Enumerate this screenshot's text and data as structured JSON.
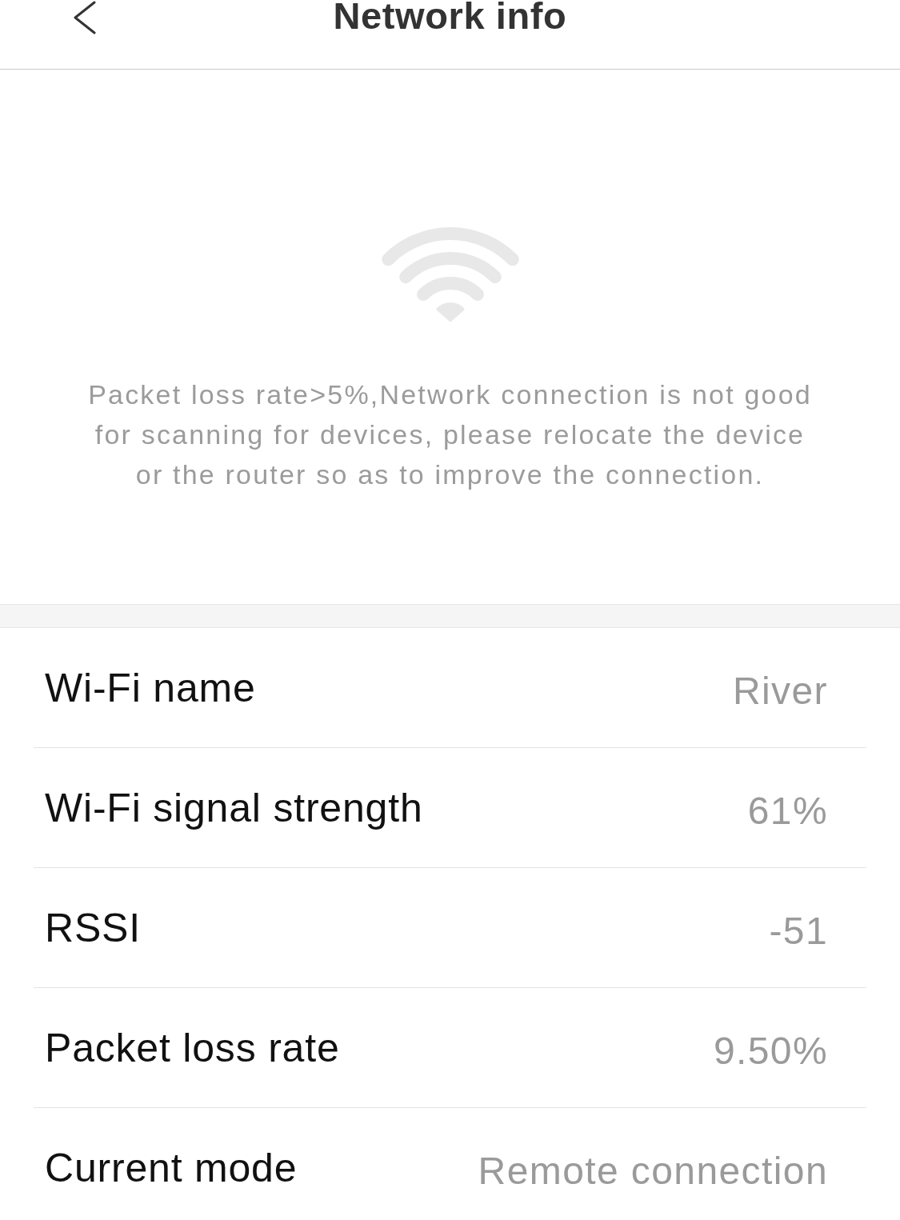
{
  "header": {
    "title": "Network info"
  },
  "notice": {
    "message": "Packet loss rate>5%,Network connection is not good for scanning for devices, please relocate the device or the router so as to improve the connection."
  },
  "info_rows": [
    {
      "label": "Wi-Fi name",
      "value": "River"
    },
    {
      "label": "Wi-Fi signal strength",
      "value": "61%"
    },
    {
      "label": "RSSI",
      "value": "-51"
    },
    {
      "label": "Packet loss rate",
      "value": "9.50%"
    },
    {
      "label": "Current mode",
      "value": "Remote connection"
    }
  ]
}
